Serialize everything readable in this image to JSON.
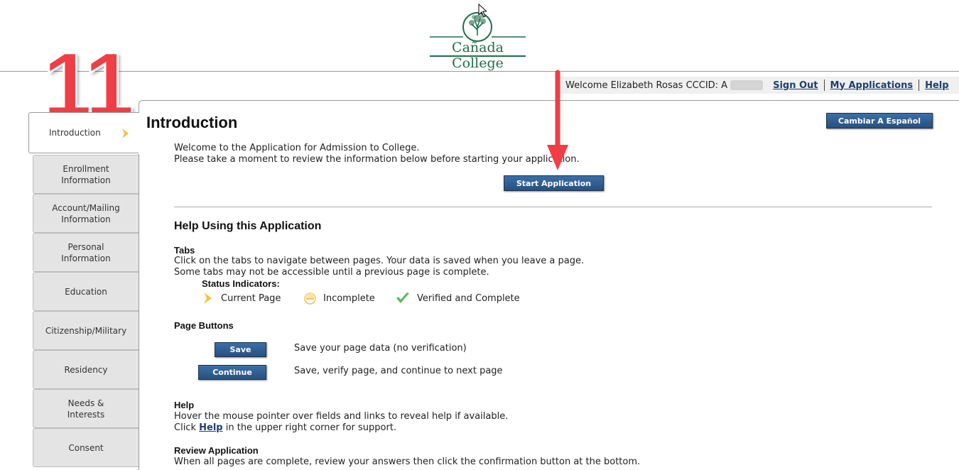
{
  "header": {
    "logo_text": "Cañada College",
    "annotation_number": "11"
  },
  "topbar": {
    "welcome": "Welcome Elizabeth Rosas CCCID: A",
    "sign_out": "Sign Out",
    "my_applications": "My Applications",
    "help": "Help"
  },
  "sidebar": {
    "tabs": [
      {
        "label": "Introduction"
      },
      {
        "label": "Enrollment Information"
      },
      {
        "label": "Account/Mailing Information"
      },
      {
        "label": "Personal Information"
      },
      {
        "label": "Education"
      },
      {
        "label": "Citizenship/Military"
      },
      {
        "label": "Residency"
      },
      {
        "label": "Needs & Interests"
      },
      {
        "label": "Consent"
      }
    ]
  },
  "main": {
    "title": "Introduction",
    "spanish_button": "Cambiar A Español",
    "welcome_line1": "Welcome to the Application for Admission to College.",
    "welcome_line2": "Please take a moment to review the information below before starting your application.",
    "start_button": "Start Application",
    "help_heading": "Help Using this Application",
    "tabs_heading": "Tabs",
    "tabs_line1": "Click on the tabs to navigate between pages. Your data is saved when you leave a page.",
    "tabs_line2": "Some tabs may not be accessible until a previous page is complete.",
    "status_heading": "Status Indicators:",
    "status_current": "Current Page",
    "status_incomplete": "Incomplete",
    "status_verified": "Verified and Complete",
    "page_buttons_heading": "Page Buttons",
    "save_button": "Save",
    "save_desc": "Save your page data (no verification)",
    "continue_button": "Continue",
    "continue_desc": "Save, verify page, and continue to next page",
    "help_section_heading": "Help",
    "help_line1": "Hover the mouse pointer over fields and links to reveal help if available.",
    "help_line2_prefix": "Click",
    "help_line2_link": "Help",
    "help_line2_suffix": "in the upper right corner for support.",
    "review_heading": "Review Application",
    "review_line": "When all pages are complete, review your answers then click the confirmation button at the bottom."
  },
  "colors": {
    "brand_green": "#1e6d4c",
    "button_blue": "#2e5b8e",
    "annotation_red": "#ef3e44",
    "indicator_yellow": "#f5c242",
    "indicator_green": "#5cb85c"
  }
}
